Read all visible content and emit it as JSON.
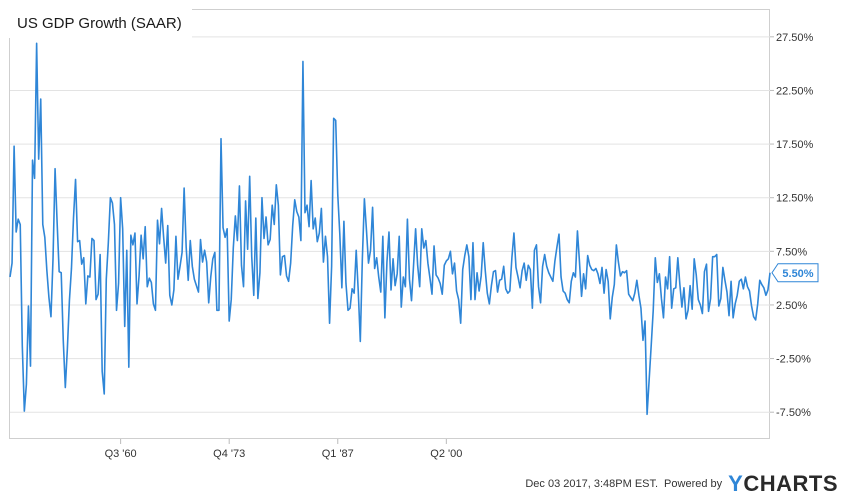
{
  "chart_data": {
    "type": "line",
    "title": "US GDP Growth (SAAR)",
    "xlabel": "",
    "ylabel": "",
    "x_start": "Q1 '47",
    "x_end": "Q3 '17",
    "x_tick_labels": [
      "Q3 '60",
      "Q4 '73",
      "Q1 '87",
      "Q2 '00"
    ],
    "y_ticks": [
      -7.5,
      -2.5,
      2.5,
      7.5,
      12.5,
      17.5,
      22.5,
      27.5
    ],
    "y_tick_labels": [
      "-7.50%",
      "-2.50%",
      "2.50%",
      "7.50%",
      "12.50%",
      "17.50%",
      "22.50%",
      "27.50%"
    ],
    "ylim": [
      -10.0,
      30.0
    ],
    "grid": true,
    "series": [
      {
        "name": "",
        "color": "#2f86d7",
        "last_value_label": "5.50%",
        "values": [
          5.1,
          6.4,
          17.3,
          9.3,
          10.5,
          10.0,
          -1.3,
          -7.4,
          -4.9,
          2.4,
          -3.2,
          16.0,
          14.3,
          26.9,
          16.1,
          21.7,
          10.0,
          8.8,
          5.7,
          3.2,
          1.4,
          6.8,
          15.2,
          10.2,
          5.6,
          5.5,
          -0.8,
          -5.2,
          -1.6,
          2.9,
          5.9,
          10.6,
          14.2,
          8.4,
          8.5,
          6.3,
          6.9,
          2.6,
          5.2,
          5.1,
          8.7,
          8.5,
          3.0,
          3.5,
          7.2,
          -3.7,
          -5.8,
          4.9,
          8.3,
          12.5,
          12.0,
          10.0,
          2.0,
          4.5,
          12.5,
          9.6,
          0.5,
          7.6,
          -3.3,
          9.0,
          8.1,
          9.2,
          2.6,
          5.2,
          9.0,
          6.8,
          9.8,
          4.2,
          5.0,
          4.6,
          2.6,
          2.0,
          10.4,
          8.2,
          11.5,
          8.8,
          6.4,
          9.9,
          3.4,
          2.5,
          3.9,
          8.9,
          4.9,
          6.1,
          7.4,
          13.4,
          7.9,
          4.8,
          8.5,
          6.1,
          4.9,
          4.3,
          3.7,
          8.6,
          6.5,
          7.6,
          6.5,
          2.7,
          5.1,
          6.8,
          7.4,
          2.0,
          2.0,
          18.0,
          9.7,
          8.8,
          9.6,
          1.0,
          3.0,
          7.8,
          10.8,
          8.5,
          13.6,
          6.2,
          4.2,
          12.2,
          7.7,
          14.5,
          7.0,
          3.4,
          10.6,
          3.1,
          5.5,
          12.5,
          8.7,
          10.7,
          8.1,
          8.6,
          11.8,
          10.0,
          13.7,
          11.8,
          5.3,
          7.0,
          7.1,
          5.2,
          4.7,
          6.4,
          9.9,
          12.3,
          11.2,
          10.7,
          8.5,
          25.2,
          11.1,
          11.8,
          9.8,
          14.1,
          9.6,
          10.6,
          8.4,
          9.2,
          11.5,
          6.5,
          8.9,
          7.0,
          0.8,
          6.1,
          19.9,
          19.7,
          12.8,
          9.1,
          4.1,
          10.3,
          4.5,
          2.0,
          2.2,
          4.0,
          3.6,
          7.6,
          3.8,
          -0.9,
          6.8,
          12.4,
          9.5,
          6.4,
          7.6,
          11.6,
          5.9,
          6.9,
          5.1,
          3.7,
          8.9,
          1.3,
          6.5,
          9.3,
          3.9,
          6.8,
          4.3,
          5.4,
          8.9,
          2.3,
          5.1,
          4.2,
          10.5,
          4.9,
          2.9,
          6.2,
          9.6,
          6.2,
          4.2,
          9.6,
          7.8,
          8.5,
          6.4,
          5.0,
          3.5,
          8.0,
          5.3,
          5.0,
          4.5,
          3.5,
          6.2,
          6.6,
          6.8,
          7.5,
          5.4,
          6.4,
          3.8,
          3.0,
          0.8,
          5.8,
          7.1,
          8.1,
          7.0,
          3.0,
          8.3,
          3.0,
          5.5,
          3.8,
          5.2,
          8.3,
          5.7,
          3.6,
          2.6,
          4.3,
          5.6,
          5.7,
          3.7,
          4.8,
          4.9,
          6.1,
          4.0,
          3.6,
          3.8,
          6.9,
          9.2,
          6.0,
          5.1,
          4.1,
          5.7,
          6.4,
          4.8,
          6.2,
          5.8,
          2.2,
          7.6,
          8.1,
          4.2,
          2.7,
          6.1,
          7.2,
          6.1,
          5.5,
          5.1,
          4.7,
          6.6,
          7.9,
          9.1,
          5.1,
          3.8,
          3.6,
          3.0,
          2.7,
          4.7,
          5.5,
          5.1,
          9.4,
          6.5,
          3.3,
          5.4,
          4.0,
          7.1,
          6.2,
          5.8,
          5.7,
          5.9,
          5.4,
          4.5,
          6.0,
          3.6,
          5.8,
          4.7,
          1.2,
          3.2,
          4.4,
          8.1,
          6.5,
          5.2,
          5.6,
          5.5,
          5.7,
          3.5,
          3.2,
          2.9,
          3.6,
          4.8,
          3.4,
          2.2,
          -0.8,
          1.0,
          -7.7,
          -4.5,
          -1.3,
          2.0,
          6.9,
          4.6,
          5.4,
          3.1,
          1.3,
          5.1,
          4.0,
          7.0,
          2.2,
          4.0,
          4.1,
          6.9,
          4.4,
          2.3,
          4.1,
          1.2,
          2.0,
          4.3,
          2.1,
          6.8,
          5.3,
          3.0,
          2.5,
          1.7,
          5.6,
          6.3,
          1.9,
          3.1,
          7.0,
          7.0,
          7.2,
          2.4,
          3.1,
          6.0,
          4.8,
          3.7,
          1.5,
          4.7,
          1.3,
          2.6,
          3.4,
          4.7,
          4.9,
          4.0,
          5.1,
          4.2,
          3.8,
          2.4,
          1.4,
          1.1,
          2.6,
          4.8,
          4.4,
          4.1,
          3.4,
          3.9,
          5.5
        ]
      }
    ]
  },
  "footer": {
    "timestamp": "Dec 03 2017, 3:48PM EST.",
    "powered_by": "Powered by",
    "logo_y": "Y",
    "logo_rest": "CHARTS"
  }
}
